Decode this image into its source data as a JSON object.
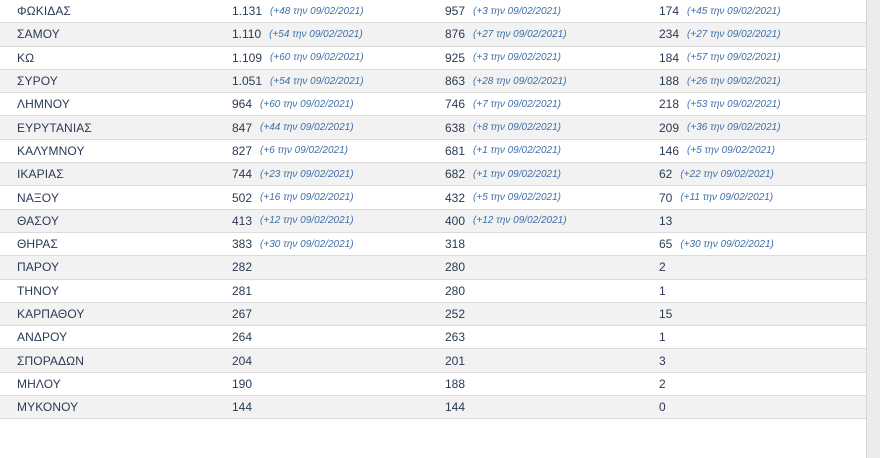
{
  "table": {
    "rows": [
      {
        "name": "ΦΩΚΙΔΑΣ",
        "v1": "1.131",
        "d1": "(+48 την 09/02/2021)",
        "v2": "957",
        "d2": "(+3 την 09/02/2021)",
        "v3": "174",
        "d3": "(+45 την 09/02/2021)"
      },
      {
        "name": "ΣΑΜΟΥ",
        "v1": "1.110",
        "d1": "(+54 την 09/02/2021)",
        "v2": "876",
        "d2": "(+27 την 09/02/2021)",
        "v3": "234",
        "d3": "(+27 την 09/02/2021)"
      },
      {
        "name": "ΚΩ",
        "v1": "1.109",
        "d1": "(+60 την 09/02/2021)",
        "v2": "925",
        "d2": "(+3 την 09/02/2021)",
        "v3": "184",
        "d3": "(+57 την 09/02/2021)"
      },
      {
        "name": "ΣΥΡΟΥ",
        "v1": "1.051",
        "d1": "(+54 την 09/02/2021)",
        "v2": "863",
        "d2": "(+28 την 09/02/2021)",
        "v3": "188",
        "d3": "(+26 την 09/02/2021)"
      },
      {
        "name": "ΛΗΜΝΟΥ",
        "v1": "964",
        "d1": "(+60 την 09/02/2021)",
        "v2": "746",
        "d2": "(+7 την 09/02/2021)",
        "v3": "218",
        "d3": "(+53 την 09/02/2021)"
      },
      {
        "name": "ΕΥΡΥΤΑΝΙΑΣ",
        "v1": "847",
        "d1": "(+44 την 09/02/2021)",
        "v2": "638",
        "d2": "(+8 την 09/02/2021)",
        "v3": "209",
        "d3": "(+36 την 09/02/2021)"
      },
      {
        "name": "ΚΑΛΥΜΝΟΥ",
        "v1": "827",
        "d1": "(+6 την 09/02/2021)",
        "v2": "681",
        "d2": "(+1 την 09/02/2021)",
        "v3": "146",
        "d3": "(+5 την 09/02/2021)"
      },
      {
        "name": "ΙΚΑΡΙΑΣ",
        "v1": "744",
        "d1": "(+23 την 09/02/2021)",
        "v2": "682",
        "d2": "(+1 την 09/02/2021)",
        "v3": "62",
        "d3": "(+22 την 09/02/2021)"
      },
      {
        "name": "ΝΑΞΟΥ",
        "v1": "502",
        "d1": "(+16 την 09/02/2021)",
        "v2": "432",
        "d2": "(+5 την 09/02/2021)",
        "v3": "70",
        "d3": "(+11 την 09/02/2021)"
      },
      {
        "name": "ΘΑΣΟΥ",
        "v1": "413",
        "d1": "(+12 την 09/02/2021)",
        "v2": "400",
        "d2": "(+12 την 09/02/2021)",
        "v3": "13",
        "d3": ""
      },
      {
        "name": "ΘΗΡΑΣ",
        "v1": "383",
        "d1": "(+30 την 09/02/2021)",
        "v2": "318",
        "d2": "",
        "v3": "65",
        "d3": "(+30 την 09/02/2021)"
      },
      {
        "name": "ΠΑΡΟΥ",
        "v1": "282",
        "d1": "",
        "v2": "280",
        "d2": "",
        "v3": "2",
        "d3": ""
      },
      {
        "name": "ΤΗΝΟΥ",
        "v1": "281",
        "d1": "",
        "v2": "280",
        "d2": "",
        "v3": "1",
        "d3": ""
      },
      {
        "name": "ΚΑΡΠΑΘΟΥ",
        "v1": "267",
        "d1": "",
        "v2": "252",
        "d2": "",
        "v3": "15",
        "d3": ""
      },
      {
        "name": "ΑΝΔΡΟΥ",
        "v1": "264",
        "d1": "",
        "v2": "263",
        "d2": "",
        "v3": "1",
        "d3": ""
      },
      {
        "name": "ΣΠΟΡΑΔΩΝ",
        "v1": "204",
        "d1": "",
        "v2": "201",
        "d2": "",
        "v3": "3",
        "d3": ""
      },
      {
        "name": "ΜΗΛΟΥ",
        "v1": "190",
        "d1": "",
        "v2": "188",
        "d2": "",
        "v3": "2",
        "d3": ""
      },
      {
        "name": "ΜΥΚΟΝΟΥ",
        "v1": "144",
        "d1": "",
        "v2": "144",
        "d2": "",
        "v3": "0",
        "d3": ""
      }
    ]
  }
}
